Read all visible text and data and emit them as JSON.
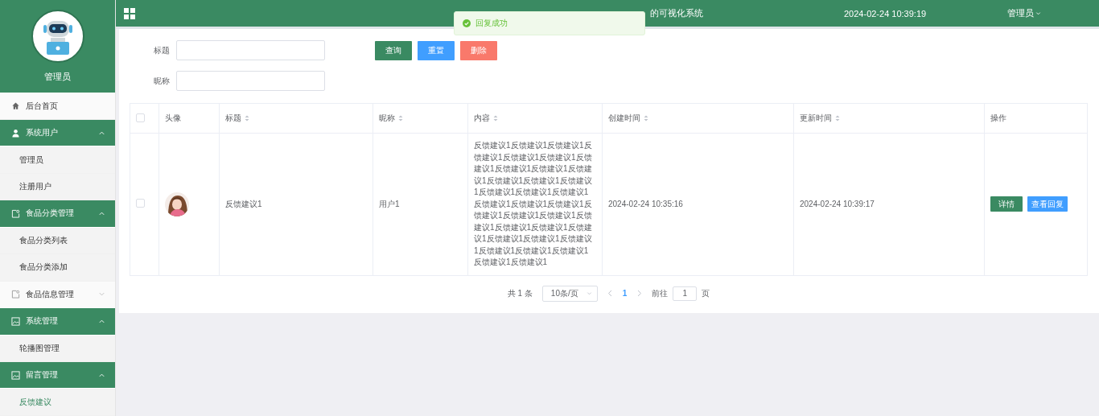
{
  "sidebar": {
    "user": "管理员",
    "items": [
      {
        "kind": "link",
        "label": "后台首页",
        "selected": false
      },
      {
        "kind": "group",
        "label": "系统用户",
        "expanded": true,
        "children": [
          {
            "label": "管理员",
            "selected": false
          },
          {
            "label": "注册用户",
            "selected": false
          }
        ]
      },
      {
        "kind": "group",
        "label": "食品分类管理",
        "expanded": true,
        "children": [
          {
            "label": "食品分类列表",
            "selected": false
          },
          {
            "label": "食品分类添加",
            "selected": false
          }
        ]
      },
      {
        "kind": "group",
        "label": "食品信息管理",
        "expanded": false
      },
      {
        "kind": "group",
        "label": "系统管理",
        "expanded": true,
        "children": [
          {
            "label": "轮播图管理",
            "selected": false
          }
        ]
      },
      {
        "kind": "group",
        "label": "留言管理",
        "expanded": true,
        "children": [
          {
            "label": "反馈建议",
            "selected": true
          }
        ]
      }
    ]
  },
  "topbar": {
    "title": "的可视化系统",
    "datetime": "2024-02-24 10:39:19",
    "user": "管理员"
  },
  "toast": {
    "message": "回复成功"
  },
  "search": {
    "fields": [
      {
        "label": "标题"
      },
      {
        "label": "昵称"
      }
    ],
    "buttons": [
      {
        "label": "查询",
        "kind": "primary"
      },
      {
        "label": "重置",
        "kind": "info"
      },
      {
        "label": "删除",
        "kind": "danger"
      }
    ]
  },
  "table": {
    "select_all_checked": false,
    "columns": [
      {
        "label": "头像",
        "sortable": false
      },
      {
        "label": "标题",
        "sortable": true
      },
      {
        "label": "昵称",
        "sortable": true
      },
      {
        "label": "内容",
        "sortable": true
      },
      {
        "label": "创建时间",
        "sortable": true
      },
      {
        "label": "更新时间",
        "sortable": true
      },
      {
        "label": "操作",
        "sortable": false
      }
    ],
    "rows": [
      {
        "checked": false,
        "avatar": {
          "kind": "picture"
        },
        "title": "反馈建议1",
        "nickname": "用户1",
        "content": "反馈建议1反馈建议1反馈建议1反馈建议1反馈建议1反馈建议1反馈建议1反馈建议1反馈建议1反馈建议1反馈建议1反馈建议1反馈建议1反馈建议1反馈建议1反馈建议1反馈建议1反馈建议1反馈建议1反馈建议1反馈建议1反馈建议1反馈建议1反馈建议1反馈建议1反馈建议1反馈建议1反馈建议1反馈建议1反馈建议1反馈建议1反馈建议1反馈建议1反馈建议1",
        "created": "2024-02-24 10:35:16",
        "updated": "2024-02-24 10:39:17",
        "actions": [
          {
            "label": "详情",
            "kind": "primary"
          },
          {
            "label": "查看回复",
            "kind": "info"
          }
        ]
      }
    ]
  },
  "pagination": {
    "total": "共 1 条",
    "page_size": "10条/页",
    "prev_disabled": true,
    "next_disabled": true,
    "pages": [
      {
        "label": "1",
        "selected": true
      }
    ],
    "goto_label": "前往",
    "goto_value": "1",
    "goto_suffix": "页"
  }
}
